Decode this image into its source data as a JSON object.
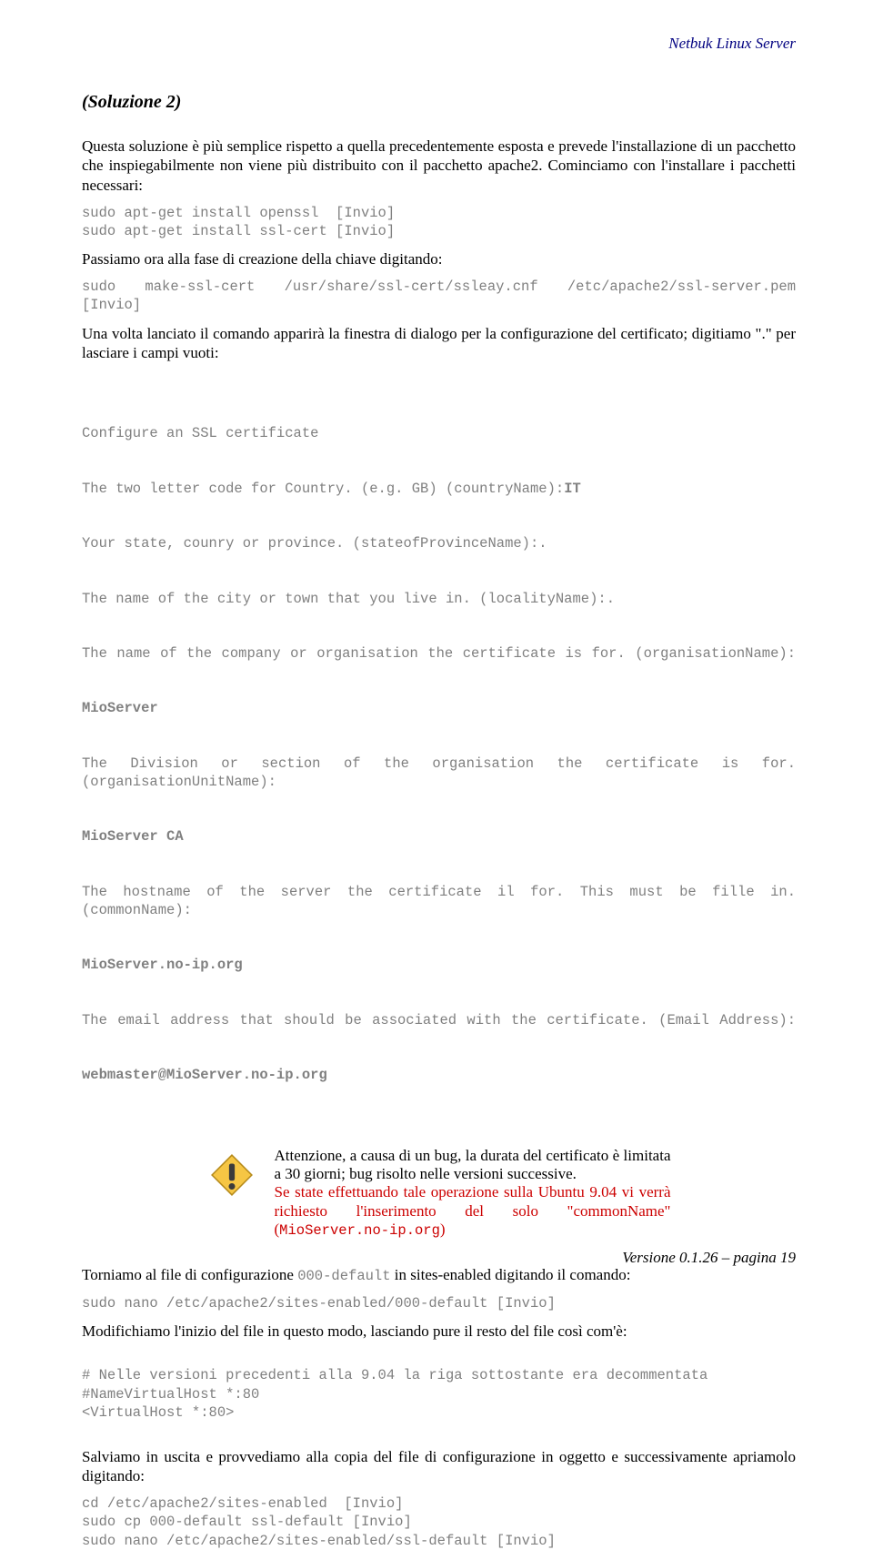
{
  "header": {
    "right": "Netbuk Linux Server"
  },
  "footer": {
    "right": "Versione 0.1.26 – pagina 19"
  },
  "body": {
    "heading": "(Soluzione 2)",
    "p1": "Questa soluzione è più semplice rispetto a quella precedentemente esposta e prevede l'installazione di un pacchetto che inspiegabilmente non viene più distribuito con il pacchetto apache2. Cominciamo con l'installare i pacchetti necessari:",
    "code1": "sudo apt-get install openssl  [Invio]\nsudo apt-get install ssl-cert [Invio]",
    "p2": "Passiamo ora alla fase di creazione della chiave digitando:",
    "code2": "sudo make-ssl-cert /usr/share/ssl-cert/ssleay.cnf /etc/apache2/ssl-server.pem [Invio]",
    "p3": "Una volta lanciato il comando apparirà la finestra di dialogo per la configurazione del certificato; digitiamo \".\" per lasciare i campi vuoti:",
    "certificate": {
      "l1": "Configure an SSL certificate",
      "l2a": "The two letter code for Country. (e.g. GB) (countryName):",
      "l2b": "IT",
      "l3": "Your state, counry or province. (stateofProvinceName):.",
      "l4": "The name of the city or town that you live in. (localityName):.",
      "l5": "The name of the company or organisation the certificate is for. (organisationName):",
      "l5b": "MioServer",
      "l6": "The Division or section of the organisation the certificate is for. (organisationUnitName):",
      "l6b": "MioServer CA",
      "l7": "The hostname of the server the certificate il for. This must be fille in. (commonName):",
      "l7b": "MioServer.no-ip.org",
      "l8": "The email address that should be associated with the certificate. (Email Address):",
      "l8b": "webmaster@MioServer.no-ip.org"
    },
    "callout": {
      "t1": "Attenzione, a causa di un bug, la durata del certificato è limitata a 30 giorni; bug risolto nelle versioni successive.",
      "t2a": "Se state effettuando tale operazione sulla Ubuntu 9.04 vi verrà richiesto l'inserimento del solo \"commonName\" (",
      "t2b": "MioServer.no-ip.org",
      "t2c": ")"
    },
    "p4a": "Torniamo al file di configurazione ",
    "p4code": "000-default",
    "p4b": " in sites-enabled digitando il comando:",
    "code4": "sudo nano /etc/apache2/sites-enabled/000-default [Invio]",
    "p5": "Modifichiamo l'inizio del file in questo modo, lasciando pure il resto del file così com'è:",
    "code5": "# Nelle versioni precedenti alla 9.04 la riga sottostante era decommentata\n#NameVirtualHost *:80\n<VirtualHost *:80>",
    "p6": "Salviamo in uscita e provvediamo alla copia del file di configurazione in oggetto e successivamente apriamolo digitando:",
    "code6": "cd /etc/apache2/sites-enabled  [Invio]\nsudo cp 000-default ssl-default [Invio]\nsudo nano /etc/apache2/sites-enabled/ssl-default [Invio]"
  }
}
